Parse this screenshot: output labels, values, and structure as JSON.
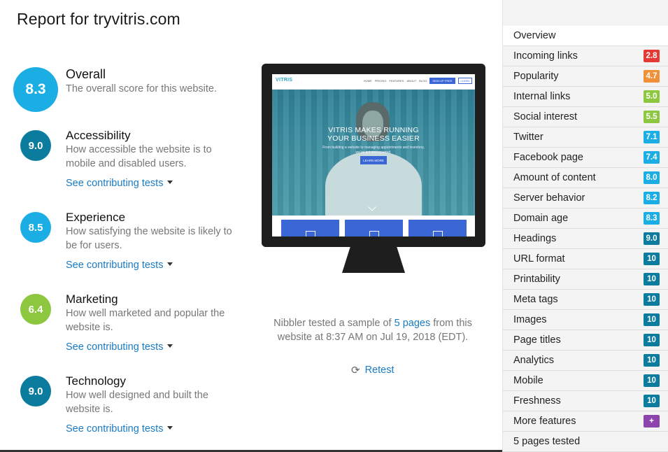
{
  "page": {
    "title": "Report for tryvitris.com"
  },
  "categories": [
    {
      "key": "overall",
      "score": "8.3",
      "name": "Overall",
      "description": "The overall score for this website.",
      "color": "#1aaee5",
      "link": ""
    },
    {
      "key": "accessibility",
      "score": "9.0",
      "name": "Accessibility",
      "description": "How accessible the website is to mobile and disabled users.",
      "color": "#0b7b9e",
      "link": "See contributing tests"
    },
    {
      "key": "experience",
      "score": "8.5",
      "name": "Experience",
      "description": "How satisfying the website is likely to be for users.",
      "color": "#1aaee5",
      "link": "See contributing tests"
    },
    {
      "key": "marketing",
      "score": "6.4",
      "name": "Marketing",
      "description": "How well marketed and popular the website is.",
      "color": "#8dc63f",
      "link": "See contributing tests"
    },
    {
      "key": "technology",
      "score": "9.0",
      "name": "Technology",
      "description": "How well designed and built the website is.",
      "color": "#0b7b9e",
      "link": "See contributing tests"
    }
  ],
  "preview": {
    "logo": "VITRIS",
    "nav_links": [
      "HOME",
      "PRICING",
      "FEATURES",
      "ABOUT",
      "BLOG"
    ],
    "nav_button_primary": "SIGN UP FREE",
    "nav_button_secondary": "LOGIN",
    "hero_title": "VITRIS MAKES RUNNING YOUR BUSINESS EASIER",
    "hero_subtitle": "From building a website to managing appointments and inventory, we've got you covered.",
    "hero_button": "LEARN MORE"
  },
  "summary": {
    "prefix": "Nibbler tested a sample of ",
    "pages_link": "5 pages",
    "suffix": " from this website at 8:37 AM on Jul 19, 2018 (EDT).",
    "retest_label": "Retest",
    "retest_icon": "refresh-icon"
  },
  "sidebar": {
    "items": [
      {
        "label": "Overview",
        "badge": "",
        "color": "",
        "active": true
      },
      {
        "label": "Incoming links",
        "badge": "2.8",
        "color": "#e53935"
      },
      {
        "label": "Popularity",
        "badge": "4.7",
        "color": "#f0913a"
      },
      {
        "label": "Internal links",
        "badge": "5.0",
        "color": "#8dc63f"
      },
      {
        "label": "Social interest",
        "badge": "5.5",
        "color": "#8dc63f"
      },
      {
        "label": "Twitter",
        "badge": "7.1",
        "color": "#1aaee5"
      },
      {
        "label": "Facebook page",
        "badge": "7.4",
        "color": "#1aaee5"
      },
      {
        "label": "Amount of content",
        "badge": "8.0",
        "color": "#1aaee5"
      },
      {
        "label": "Server behavior",
        "badge": "8.2",
        "color": "#1aaee5"
      },
      {
        "label": "Domain age",
        "badge": "8.3",
        "color": "#1aaee5"
      },
      {
        "label": "Headings",
        "badge": "9.0",
        "color": "#0b7b9e"
      },
      {
        "label": "URL format",
        "badge": "10",
        "color": "#0b7b9e"
      },
      {
        "label": "Printability",
        "badge": "10",
        "color": "#0b7b9e"
      },
      {
        "label": "Meta tags",
        "badge": "10",
        "color": "#0b7b9e"
      },
      {
        "label": "Images",
        "badge": "10",
        "color": "#0b7b9e"
      },
      {
        "label": "Page titles",
        "badge": "10",
        "color": "#0b7b9e"
      },
      {
        "label": "Analytics",
        "badge": "10",
        "color": "#0b7b9e"
      },
      {
        "label": "Mobile",
        "badge": "10",
        "color": "#0b7b9e"
      },
      {
        "label": "Freshness",
        "badge": "10",
        "color": "#0b7b9e"
      },
      {
        "label": "More features",
        "badge": "+",
        "color": "#8e44ad"
      },
      {
        "label": "5 pages tested",
        "badge": "",
        "color": ""
      }
    ]
  }
}
